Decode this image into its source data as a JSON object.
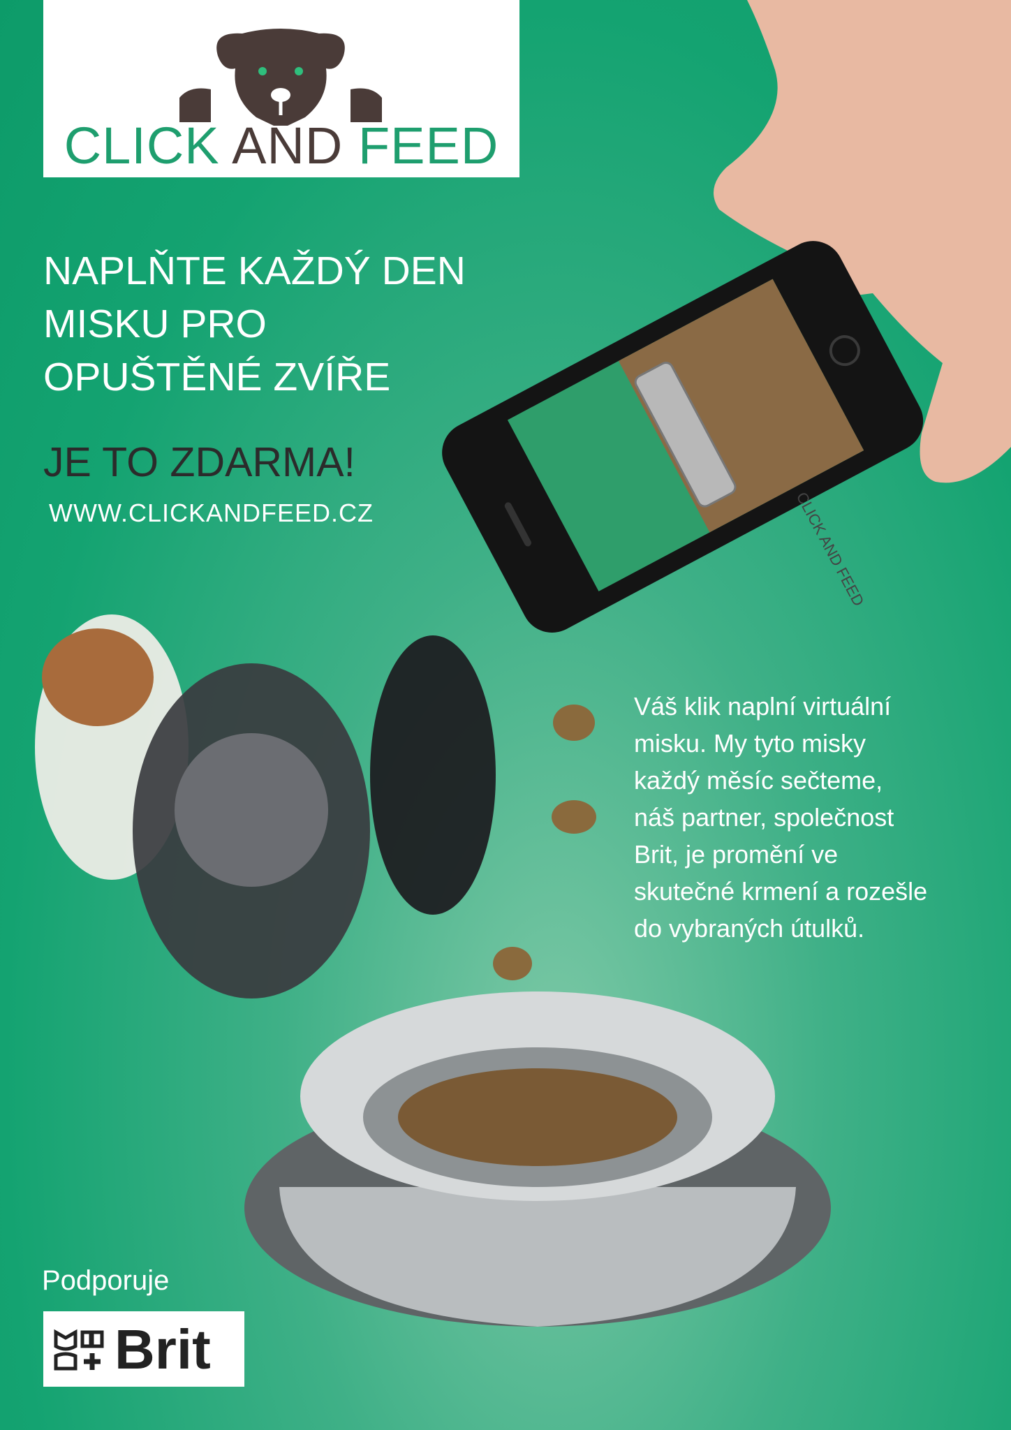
{
  "logo": {
    "word1": "CLICK",
    "word2": "AND",
    "word3": "FEED"
  },
  "headline": {
    "line1": "NAPLŇTE KAŽDÝ DEN",
    "line2": "MISKU PRO",
    "line3": "OPUŠTĚNÉ ZVÍŘE"
  },
  "free_text": "JE TO ZDARMA!",
  "url": "WWW.CLICKANDFEED.CZ",
  "description": {
    "line1": "Váš klik naplní virtuální",
    "line2": "misku. My tyto misky",
    "line3": "každý měsíc sečteme,",
    "line4": "náš partner, společnost",
    "line5": "Brit, je promění ve",
    "line6": "skutečné krmení a rozešle",
    "line7": "do vybraných útulků."
  },
  "phone_button": "CLICK AND FEED",
  "sponsor": {
    "label": "Podporuje",
    "brand": "Brit"
  },
  "colors": {
    "brand_green": "#1e9e6e",
    "brand_brown": "#4a3b38",
    "background": "#14a371"
  },
  "icons": [
    "dog-logo-icon",
    "brit-paw-icon"
  ]
}
